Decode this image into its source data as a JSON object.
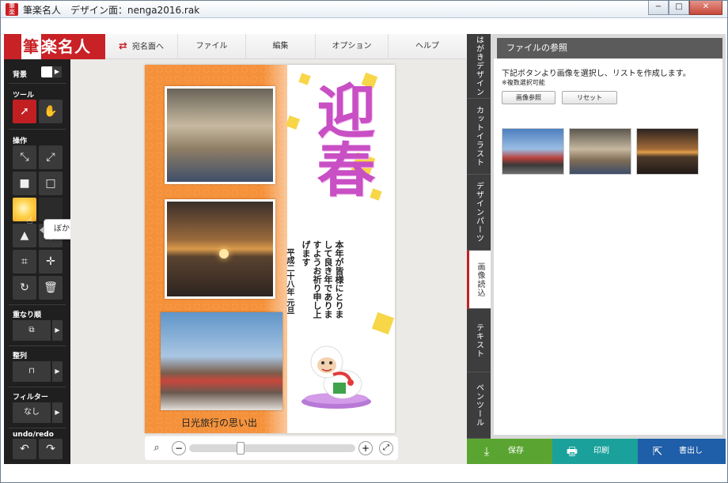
{
  "window": {
    "title": "筆楽名人　デザイン面：nenga2016.rak",
    "controls": {
      "minimize": "−",
      "maximize": "□",
      "close": "✕"
    }
  },
  "logo": {
    "mark": "筆",
    "text": "楽名人"
  },
  "menu": {
    "items": [
      {
        "label": "宛名面へ",
        "icon": "swap-icon"
      },
      {
        "label": "ファイル"
      },
      {
        "label": "編集"
      },
      {
        "label": "オプション"
      },
      {
        "label": "ヘルプ"
      }
    ]
  },
  "lefttools": {
    "background_label": "背景",
    "tools_label": "ツール",
    "operation_label": "操作",
    "overlap_label": "重なり順",
    "align_label": "整列",
    "filter_label": "フィルター",
    "filter_value": "なし",
    "undo_label": "undo/redo",
    "tooltip": "ぼかす"
  },
  "card": {
    "greeting": "迎春",
    "message": "本年が皆様にとりまして良き年でありますようお祈り申し上げます",
    "date": "平成二十八年 元旦",
    "caption": "日光旅行の思い出"
  },
  "zoom": {
    "search_icon": "magnifier-icon",
    "minus": "−",
    "plus": "+",
    "fit": "⤢",
    "level": 0.3
  },
  "vtabs": [
    {
      "label": "はがきデザイン",
      "active": false
    },
    {
      "label": "カットイラスト",
      "active": false
    },
    {
      "label": "デザインパーツ",
      "active": false
    },
    {
      "label": "画像読込",
      "active": true
    },
    {
      "label": "テキスト",
      "active": false
    },
    {
      "label": "ペンツール",
      "active": false
    }
  ],
  "panel": {
    "title": "ファイルの参照",
    "description": "下記ボタンより画像を選択し、リストを作成します。",
    "note": "※複数選択可能",
    "browse_button": "画像参照",
    "reset_button": "リセット",
    "thumbnails": [
      "bridge-photo",
      "monkey-carving-photo",
      "sunset-photo"
    ]
  },
  "bottom": {
    "save": {
      "label": "保存",
      "color": "#5aa532"
    },
    "print": {
      "label": "印刷",
      "color": "#1aa19b"
    },
    "export": {
      "label": "書出し",
      "color": "#1f5ea8"
    }
  },
  "colors": {
    "brand_red": "#c82126",
    "toolbar_dark": "#1f1f1f",
    "card_orange": "#f5913a",
    "greeting_purple": "#c84fc4"
  }
}
